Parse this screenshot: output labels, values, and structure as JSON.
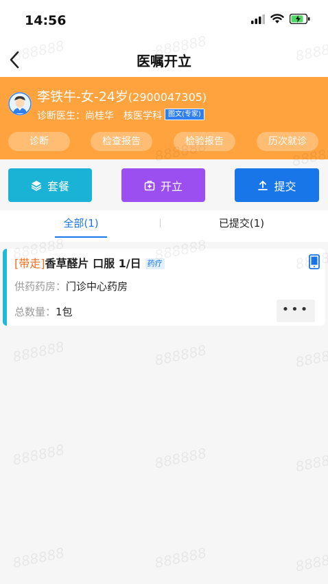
{
  "status_bar": {
    "time": "14:56"
  },
  "nav": {
    "title": "医嘱开立"
  },
  "patient": {
    "name_line": "李铁牛-女-24岁",
    "patient_id": "(2900047305)",
    "doctor_label": "诊断医生：",
    "doctor_name": "尚桂华",
    "department": "核医学科",
    "consult_badge": "图文(专家)"
  },
  "quick_tabs": [
    {
      "label": "诊断"
    },
    {
      "label": "检查报告"
    },
    {
      "label": "检验报告"
    },
    {
      "label": "历次就诊"
    }
  ],
  "actions": [
    {
      "label": "套餐",
      "icon": "layers-icon",
      "color": "#1ab3d6"
    },
    {
      "label": "开立",
      "icon": "medkit-icon",
      "color": "#9b4ff0"
    },
    {
      "label": "提交",
      "icon": "upload-icon",
      "color": "#1976e8"
    }
  ],
  "tabs": {
    "all": "全部(1)",
    "submitted": "已提交(1)"
  },
  "order": {
    "tag": "[带走]",
    "title": "香草醛片 口服 1/日",
    "type_badge": "药疗",
    "pharmacy_label": "供药药房：",
    "pharmacy_value": "门诊中心药房",
    "qty_label": "总数量：",
    "qty_value": "1包",
    "more": "•••"
  },
  "watermark": "888888",
  "colors": {
    "header_orange": "#ffa33e",
    "accent_blue": "#1976e8",
    "cyan": "#1ab3d6",
    "purple": "#9b4ff0"
  }
}
